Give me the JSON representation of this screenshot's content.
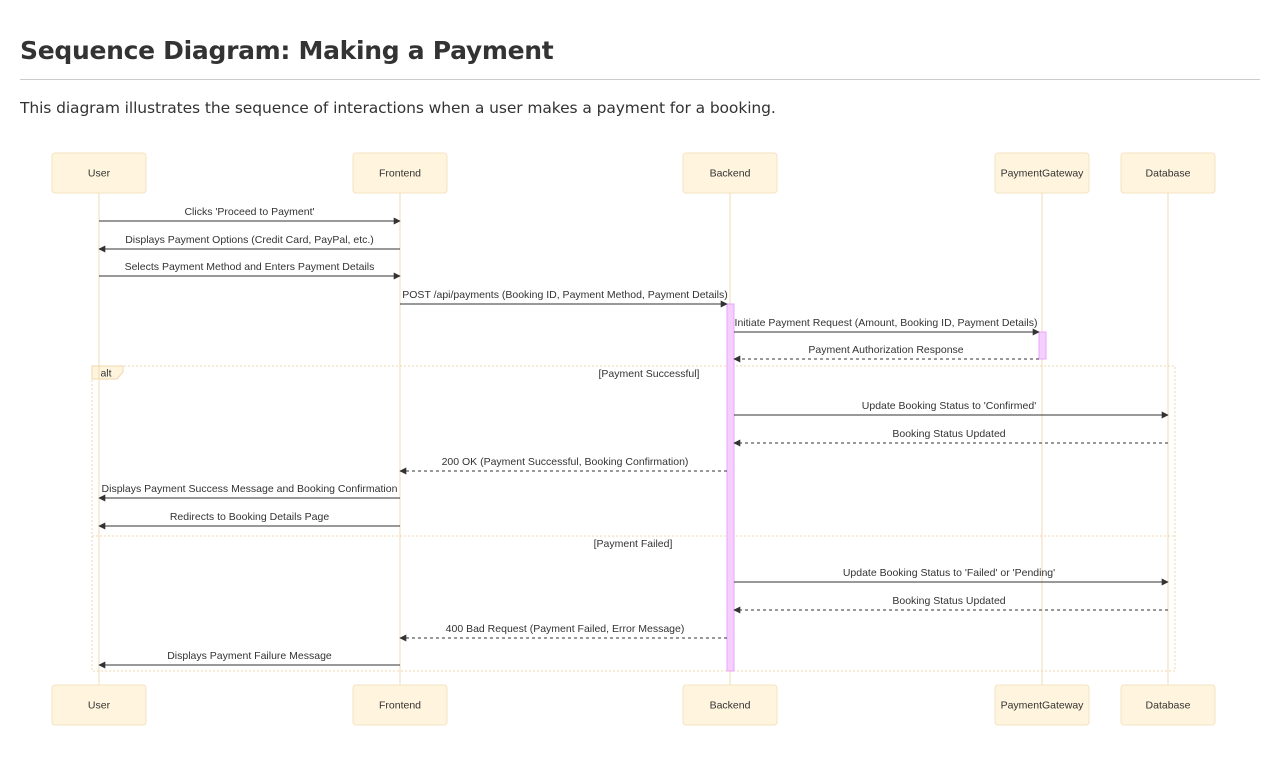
{
  "title": "Sequence Diagram: Making a Payment",
  "description": "This diagram illustrates the sequence of interactions when a user makes a payment for a booking.",
  "colors": {
    "actor_fill": "#fff4dd",
    "actor_stroke": "#f3e3c2",
    "lifeline": "#f0d9b5",
    "activation_fill": "#f5d0fe",
    "activation_stroke": "#e9a6f9",
    "arrow": "#333333",
    "label": "#333333",
    "frame": "#f1d7ad"
  },
  "diagram": {
    "participants": [
      "User",
      "Frontend",
      "Backend",
      "PaymentGateway",
      "Database"
    ],
    "messages": [
      {
        "from": "User",
        "to": "Frontend",
        "text": "Clicks 'Proceed to Payment'",
        "style": "solid"
      },
      {
        "from": "Frontend",
        "to": "User",
        "text": "Displays Payment Options (Credit Card, PayPal, etc.)",
        "style": "solid"
      },
      {
        "from": "User",
        "to": "Frontend",
        "text": "Selects Payment Method and Enters Payment Details",
        "style": "solid"
      },
      {
        "from": "Frontend",
        "to": "Backend",
        "text": "POST /api/payments (Booking ID, Payment Method, Payment Details)",
        "style": "solid"
      },
      {
        "from": "Backend",
        "to": "PaymentGateway",
        "text": "Initiate Payment Request (Amount, Booking ID, Payment Details)",
        "style": "solid"
      },
      {
        "from": "PaymentGateway",
        "to": "Backend",
        "text": "Payment Authorization Response",
        "style": "dashed"
      },
      {
        "from": "Backend",
        "to": "Database",
        "text": "Update Booking Status to 'Confirmed'",
        "style": "solid"
      },
      {
        "from": "Database",
        "to": "Backend",
        "text": "Booking Status Updated",
        "style": "dashed"
      },
      {
        "from": "Backend",
        "to": "Frontend",
        "text": "200 OK (Payment Successful, Booking Confirmation)",
        "style": "dashed"
      },
      {
        "from": "Frontend",
        "to": "User",
        "text": "Displays Payment Success Message and Booking Confirmation",
        "style": "solid"
      },
      {
        "from": "Frontend",
        "to": "User",
        "text": "Redirects to Booking Details Page",
        "style": "solid"
      },
      {
        "from": "Backend",
        "to": "Database",
        "text": "Update Booking Status to 'Failed' or 'Pending'",
        "style": "solid"
      },
      {
        "from": "Database",
        "to": "Backend",
        "text": "Booking Status Updated",
        "style": "dashed"
      },
      {
        "from": "Backend",
        "to": "Frontend",
        "text": "400 Bad Request (Payment Failed, Error Message)",
        "style": "dashed"
      },
      {
        "from": "Frontend",
        "to": "User",
        "text": "Displays Payment Failure Message",
        "style": "solid"
      }
    ],
    "alt": {
      "label": "alt",
      "sections": [
        "[Payment Successful]",
        "[Payment Failed]"
      ]
    }
  }
}
